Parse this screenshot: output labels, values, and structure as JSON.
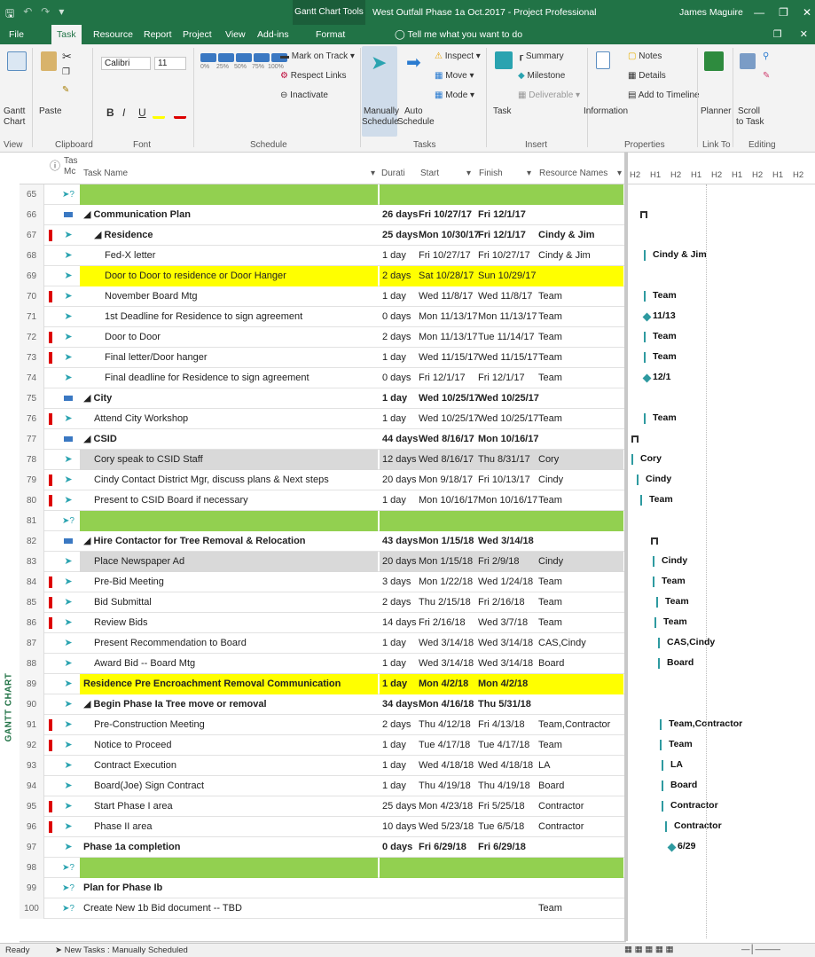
{
  "titlebar": {
    "context_tab": "Gantt Chart Tools",
    "document": "West Outfall Phase 1a Oct.2017  -  Project Professional",
    "user": "James Maguire"
  },
  "menubar": {
    "tabs": [
      "File",
      "Task",
      "Resource",
      "Report",
      "Project",
      "View",
      "Add-ins",
      "Format"
    ],
    "tell_me": "Tell me what you want to do"
  },
  "ribbon": {
    "view": {
      "gantt": "Gantt",
      "chart": "Chart",
      "label": "View"
    },
    "clipboard": {
      "paste": "Paste",
      "label": "Clipboard"
    },
    "font": {
      "family": "Calibri",
      "size": "11",
      "bold": "B",
      "italic": "I",
      "underline": "U",
      "label": "Font"
    },
    "schedule": {
      "mark_on_track": "Mark on Track",
      "respect_links": "Respect Links",
      "inactivate": "Inactivate",
      "pct": [
        "0%",
        "25%",
        "50%",
        "75%",
        "100%"
      ],
      "label": "Schedule"
    },
    "tasks": {
      "manually": "Manually",
      "schedule1": "Schedule",
      "auto": "Auto",
      "schedule2": "Schedule",
      "inspect": "Inspect",
      "move": "Move",
      "mode": "Mode",
      "label": "Tasks"
    },
    "insert": {
      "task": "Task",
      "summary": "Summary",
      "milestone": "Milestone",
      "deliverable": "Deliverable",
      "label": "Insert"
    },
    "properties": {
      "information": "Information",
      "notes": "Notes",
      "details": "Details",
      "add_to_timeline": "Add to Timeline",
      "label": "Properties"
    },
    "linkto": {
      "planner": "Planner",
      "label": "Link To"
    },
    "editing": {
      "scroll": "Scroll",
      "to_task": "to Task",
      "label": "Editing"
    }
  },
  "grid": {
    "headers": {
      "mode": "Task Mode",
      "ta": "Tas",
      "mc": "Mc",
      "name": "Task Name",
      "duration": "Durati",
      "start": "Start",
      "finish": "Finish",
      "resources": "Resource Names"
    },
    "rows": [
      {
        "num": "65",
        "name": "",
        "dur": "",
        "start": "",
        "finish": "",
        "res": "",
        "style": "green",
        "mode": "q",
        "ind": false,
        "lvl": 0
      },
      {
        "num": "66",
        "name": "◢ Communication Plan",
        "dur": "26 days",
        "start": "Fri 10/27/17",
        "finish": "Fri 12/1/17",
        "res": "",
        "style": "bold",
        "mode": "sum",
        "ind": false,
        "lvl": 0
      },
      {
        "num": "67",
        "name": "◢ Residence",
        "dur": "25 days",
        "start": "Mon 10/30/17",
        "finish": "Fri 12/1/17",
        "res": "Cindy & Jim",
        "style": "bold",
        "mode": "pin",
        "ind": true,
        "lvl": 1
      },
      {
        "num": "68",
        "name": "Fed-X letter",
        "dur": "1 day",
        "start": "Fri 10/27/17",
        "finish": "Fri 10/27/17",
        "res": "Cindy & Jim",
        "style": "",
        "mode": "pin",
        "ind": false,
        "lvl": 2
      },
      {
        "num": "69",
        "name": "Door to Door to residence or Door Hanger",
        "dur": "2 days",
        "start": "Sat 10/28/17",
        "finish": "Sun 10/29/17",
        "res": "",
        "style": "yellow",
        "mode": "pin",
        "ind": false,
        "lvl": 2
      },
      {
        "num": "70",
        "name": "November Board Mtg",
        "dur": "1 day",
        "start": "Wed 11/8/17",
        "finish": "Wed 11/8/17",
        "res": "Team",
        "style": "",
        "mode": "pin",
        "ind": true,
        "lvl": 2
      },
      {
        "num": "71",
        "name": "1st Deadline for Residence to sign agreement",
        "dur": "0 days",
        "start": "Mon 11/13/17",
        "finish": "Mon 11/13/17",
        "res": "Team",
        "style": "",
        "mode": "pin",
        "ind": false,
        "lvl": 2
      },
      {
        "num": "72",
        "name": "Door to Door",
        "dur": "2 days",
        "start": "Mon 11/13/17",
        "finish": "Tue 11/14/17",
        "res": "Team",
        "style": "",
        "mode": "pin",
        "ind": true,
        "lvl": 2
      },
      {
        "num": "73",
        "name": "Final letter/Door hanger",
        "dur": "1 day",
        "start": "Wed 11/15/17",
        "finish": "Wed 11/15/17",
        "res": "Team",
        "style": "",
        "mode": "pin",
        "ind": true,
        "lvl": 2
      },
      {
        "num": "74",
        "name": "Final deadline for Residence to sign agreement",
        "dur": "0 days",
        "start": "Fri 12/1/17",
        "finish": "Fri 12/1/17",
        "res": "Team",
        "style": "",
        "mode": "pin",
        "ind": false,
        "lvl": 2
      },
      {
        "num": "75",
        "name": "◢ City",
        "dur": "1 day",
        "start": "Wed 10/25/17",
        "finish": "Wed 10/25/17",
        "res": "",
        "style": "bold",
        "mode": "sum",
        "ind": false,
        "lvl": 0
      },
      {
        "num": "76",
        "name": "Attend City Workshop",
        "dur": "1 day",
        "start": "Wed 10/25/17",
        "finish": "Wed 10/25/17",
        "res": "Team",
        "style": "",
        "mode": "pin",
        "ind": true,
        "lvl": 1
      },
      {
        "num": "77",
        "name": "◢ CSID",
        "dur": "44 days",
        "start": "Wed 8/16/17",
        "finish": "Mon 10/16/17",
        "res": "",
        "style": "bold",
        "mode": "sum",
        "ind": false,
        "lvl": 0
      },
      {
        "num": "78",
        "name": "Cory speak to CSID Staff",
        "dur": "12 days",
        "start": "Wed 8/16/17",
        "finish": "Thu 8/31/17",
        "res": "Cory",
        "style": "gray",
        "mode": "pin",
        "ind": false,
        "lvl": 1
      },
      {
        "num": "79",
        "name": "Cindy Contact District Mgr, discuss plans & Next steps",
        "dur": "20 days",
        "start": "Mon 9/18/17",
        "finish": "Fri 10/13/17",
        "res": "Cindy",
        "style": "",
        "mode": "pin",
        "ind": true,
        "lvl": 1
      },
      {
        "num": "80",
        "name": "Present to CSID Board if necessary",
        "dur": "1 day",
        "start": "Mon 10/16/17",
        "finish": "Mon 10/16/17",
        "res": "Team",
        "style": "",
        "mode": "pin",
        "ind": true,
        "lvl": 1
      },
      {
        "num": "81",
        "name": "",
        "dur": "",
        "start": "",
        "finish": "",
        "res": "",
        "style": "green",
        "mode": "q",
        "ind": false,
        "lvl": 0
      },
      {
        "num": "82",
        "name": "◢ Hire Contactor for Tree Removal & Relocation",
        "dur": "43 days",
        "start": "Mon 1/15/18",
        "finish": "Wed 3/14/18",
        "res": "",
        "style": "bold",
        "mode": "sum",
        "ind": false,
        "lvl": 0
      },
      {
        "num": "83",
        "name": "Place Newspaper Ad",
        "dur": "20 days",
        "start": "Mon 1/15/18",
        "finish": "Fri 2/9/18",
        "res": "Cindy",
        "style": "gray",
        "mode": "pin",
        "ind": false,
        "lvl": 1
      },
      {
        "num": "84",
        "name": "Pre-Bid Meeting",
        "dur": "3 days",
        "start": "Mon 1/22/18",
        "finish": "Wed 1/24/18",
        "res": "Team",
        "style": "",
        "mode": "pin",
        "ind": true,
        "lvl": 1
      },
      {
        "num": "85",
        "name": "Bid Submittal",
        "dur": "2 days",
        "start": "Thu 2/15/18",
        "finish": "Fri 2/16/18",
        "res": "Team",
        "style": "",
        "mode": "pin",
        "ind": true,
        "lvl": 1
      },
      {
        "num": "86",
        "name": "Review Bids",
        "dur": "14 days",
        "start": "Fri 2/16/18",
        "finish": "Wed 3/7/18",
        "res": "Team",
        "style": "",
        "mode": "pin",
        "ind": true,
        "lvl": 1
      },
      {
        "num": "87",
        "name": "Present Recommendation to Board",
        "dur": "1 day",
        "start": "Wed 3/14/18",
        "finish": "Wed 3/14/18",
        "res": "CAS,Cindy",
        "style": "",
        "mode": "pin",
        "ind": false,
        "lvl": 1
      },
      {
        "num": "88",
        "name": "Award Bid --  Board Mtg",
        "dur": "1 day",
        "start": "Wed 3/14/18",
        "finish": "Wed 3/14/18",
        "res": "Board",
        "style": "",
        "mode": "pin",
        "ind": false,
        "lvl": 1
      },
      {
        "num": "89",
        "name": "Residence Pre Encroachment Removal Communication",
        "dur": "1 day",
        "start": "Mon 4/2/18",
        "finish": "Mon 4/2/18",
        "res": "",
        "style": "yellow bold",
        "mode": "pin",
        "ind": false,
        "lvl": 0
      },
      {
        "num": "90",
        "name": "◢ Begin Phase Ia Tree move or removal",
        "dur": "34 days",
        "start": "Mon 4/16/18",
        "finish": "Thu 5/31/18",
        "res": "",
        "style": "bold",
        "mode": "pin",
        "ind": false,
        "lvl": 0
      },
      {
        "num": "91",
        "name": "Pre-Construction Meeting",
        "dur": "2 days",
        "start": "Thu 4/12/18",
        "finish": "Fri 4/13/18",
        "res": "Team,Contractor",
        "style": "",
        "mode": "pin",
        "ind": true,
        "lvl": 1
      },
      {
        "num": "92",
        "name": "Notice to Proceed",
        "dur": "1 day",
        "start": "Tue 4/17/18",
        "finish": "Tue 4/17/18",
        "res": "Team",
        "style": "",
        "mode": "pin",
        "ind": true,
        "lvl": 1
      },
      {
        "num": "93",
        "name": "Contract Execution",
        "dur": "1 day",
        "start": "Wed 4/18/18",
        "finish": "Wed 4/18/18",
        "res": "LA",
        "style": "",
        "mode": "pin",
        "ind": false,
        "lvl": 1
      },
      {
        "num": "94",
        "name": "Board(Joe) Sign Contract",
        "dur": "1 day",
        "start": "Thu 4/19/18",
        "finish": "Thu 4/19/18",
        "res": "Board",
        "style": "",
        "mode": "pin",
        "ind": false,
        "lvl": 1
      },
      {
        "num": "95",
        "name": "Start Phase I area",
        "dur": "25 days",
        "start": "Mon 4/23/18",
        "finish": "Fri 5/25/18",
        "res": "Contractor",
        "style": "",
        "mode": "pin",
        "ind": true,
        "lvl": 1
      },
      {
        "num": "96",
        "name": "Phase II area",
        "dur": "10 days",
        "start": "Wed 5/23/18",
        "finish": "Tue 6/5/18",
        "res": "Contractor",
        "style": "",
        "mode": "pin",
        "ind": true,
        "lvl": 1
      },
      {
        "num": "97",
        "name": "Phase 1a completion",
        "dur": "0 days",
        "start": "Fri 6/29/18",
        "finish": "Fri 6/29/18",
        "res": "",
        "style": "bold",
        "mode": "pin",
        "ind": false,
        "lvl": 0
      },
      {
        "num": "98",
        "name": "",
        "dur": "",
        "start": "",
        "finish": "",
        "res": "",
        "style": "green",
        "mode": "q",
        "ind": false,
        "lvl": 0
      },
      {
        "num": "99",
        "name": "Plan for Phase Ib",
        "dur": "",
        "start": "",
        "finish": "",
        "res": "",
        "style": "bold",
        "mode": "q",
        "ind": false,
        "lvl": 0
      },
      {
        "num": "100",
        "name": "Create New 1b Bid document  -- TBD",
        "dur": "",
        "start": "",
        "finish": "",
        "res": "Team",
        "style": "",
        "mode": "q",
        "ind": false,
        "lvl": 0
      }
    ]
  },
  "gantt": {
    "header_labels": [
      "H2",
      "H1",
      "H2",
      "H1",
      "H2",
      "H1",
      "H2",
      "H1",
      "H2"
    ],
    "bar_labels": [
      {
        "row": 3,
        "text": "Cindy & Jim"
      },
      {
        "row": 5,
        "text": "Team"
      },
      {
        "row": 6,
        "text": "11/13"
      },
      {
        "row": 7,
        "text": "Team"
      },
      {
        "row": 8,
        "text": "Team"
      },
      {
        "row": 9,
        "text": "12/1"
      },
      {
        "row": 11,
        "text": "Team"
      },
      {
        "row": 13,
        "text": "Cory"
      },
      {
        "row": 14,
        "text": "Cindy"
      },
      {
        "row": 15,
        "text": "Team"
      },
      {
        "row": 18,
        "text": "Cindy"
      },
      {
        "row": 19,
        "text": "Team"
      },
      {
        "row": 20,
        "text": "Team"
      },
      {
        "row": 21,
        "text": "Team"
      },
      {
        "row": 22,
        "text": "CAS,Cindy"
      },
      {
        "row": 23,
        "text": "Board"
      },
      {
        "row": 26,
        "text": "Team,Contractor"
      },
      {
        "row": 27,
        "text": "Team"
      },
      {
        "row": 28,
        "text": "LA"
      },
      {
        "row": 29,
        "text": "Board"
      },
      {
        "row": 30,
        "text": "Contractor"
      },
      {
        "row": 31,
        "text": "Contractor"
      },
      {
        "row": 32,
        "text": "6/29"
      }
    ],
    "side_label": "GANTT CHART"
  },
  "status": {
    "ready": "Ready",
    "new_tasks": "New Tasks : Manually Scheduled"
  },
  "colors": {
    "accent": "#217346",
    "green_row": "#92d050",
    "yellow_row": "#ffff00",
    "bar": "#2e9aa0"
  }
}
